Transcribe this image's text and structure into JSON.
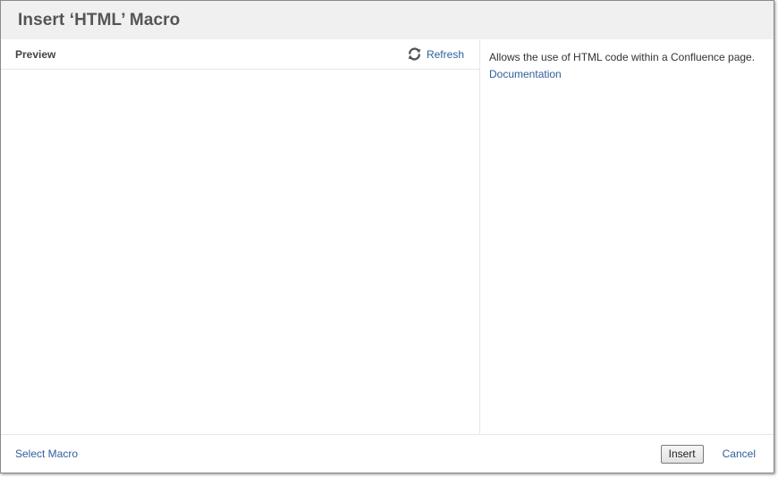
{
  "dialog": {
    "title": "Insert ‘HTML’ Macro"
  },
  "preview": {
    "title": "Preview",
    "refresh_label": "Refresh",
    "refresh_icon": "refresh-icon"
  },
  "help": {
    "description": "Allows the use of HTML code within a Confluence page.",
    "documentation_label": "Documentation"
  },
  "footer": {
    "select_macro_label": "Select Macro",
    "insert_label": "Insert",
    "cancel_label": "Cancel"
  },
  "colors": {
    "header_bg": "#f0f0f0",
    "link": "#2f5f9a",
    "title_text": "#555555"
  }
}
